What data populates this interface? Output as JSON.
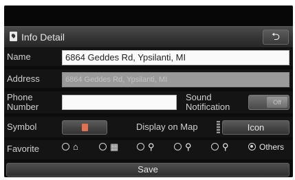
{
  "header": {
    "title": "Info Detail",
    "back_glyph": "⮌",
    "title_icon": "info-pin-icon",
    "back_icon": "back-arrow-icon"
  },
  "form": {
    "name_label": "Name",
    "name_value": "6864 Geddes Rd, Ypsilanti, MI",
    "address_label": "Address",
    "address_value": "6864 Geddes Rd, Ypsilanti, MI",
    "phone_label_line1": "Phone",
    "phone_label_line2": "Number",
    "phone_value": "",
    "sound_label_line1": "Sound",
    "sound_label_line2": "Notification",
    "sound_toggle_text": "Off",
    "symbol_label": "Symbol",
    "display_label": "Display on Map",
    "display_value": "Icon"
  },
  "favorite": {
    "label": "Favorite",
    "options": [
      {
        "icon": "home-icon",
        "glyph": "⌂",
        "selected": false
      },
      {
        "icon": "building-icon",
        "glyph": "▦",
        "selected": false
      },
      {
        "icon": "pin-star-icon",
        "glyph": "⚲",
        "selected": false
      },
      {
        "icon": "pin-star-icon",
        "glyph": "⚲",
        "selected": false
      },
      {
        "icon": "pin-star-icon",
        "glyph": "⚲",
        "selected": false
      },
      {
        "text": "Others",
        "selected": true
      }
    ]
  },
  "footer": {
    "save_label": "Save"
  },
  "colors": {
    "background": "#0c0c0c",
    "header": "#3a3a3a",
    "field": "#fafafa",
    "text": "#d0d0d0"
  }
}
